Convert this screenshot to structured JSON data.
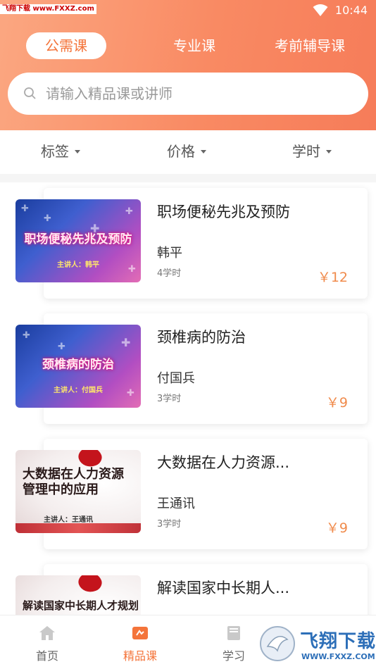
{
  "status_bar": {
    "watermark": "飞翔下载 www.FXXZ.com",
    "time": "10:44"
  },
  "tabs": [
    {
      "label": "公需课",
      "active": true
    },
    {
      "label": "专业课",
      "active": false
    },
    {
      "label": "考前辅导课",
      "active": false
    }
  ],
  "search": {
    "placeholder": "请输入精品课或讲师"
  },
  "filters": [
    {
      "label": "标签"
    },
    {
      "label": "价格"
    },
    {
      "label": "学时"
    }
  ],
  "courses": [
    {
      "thumb_title": "职场便秘先兆及预防",
      "thumb_speaker": "主讲人：韩平",
      "title": "职场便秘先兆及预防",
      "teacher": "韩平",
      "hours": "4学时",
      "price": "￥12"
    },
    {
      "thumb_title": "颈椎病的防治",
      "thumb_speaker": "主讲人：付国兵",
      "title": "颈椎病的防治",
      "teacher": "付国兵",
      "hours": "3学时",
      "price": "￥9"
    },
    {
      "thumb_title_line1": "大数据在人力资源",
      "thumb_title_line2": "管理中的应用",
      "thumb_speaker": "主讲人：王通讯",
      "title": "大数据在人力资源...",
      "teacher": "王通讯",
      "hours": "3学时",
      "price": "￥9"
    },
    {
      "thumb_title": "解读国家中长期人才规划",
      "title": "解读国家中长期人..."
    }
  ],
  "bottom_nav": [
    {
      "label": "首页",
      "icon": "home-icon",
      "active": false
    },
    {
      "label": "精品课",
      "icon": "quality-course-icon",
      "active": true
    },
    {
      "label": "学习",
      "icon": "book-icon",
      "active": false
    }
  ],
  "brand": {
    "name": "飞翔下载",
    "url": "WWW.FXXZ.COM"
  },
  "colors": {
    "accent": "#f4743a",
    "header_start": "#fba781",
    "header_end": "#f67c59",
    "price": "#f08b4c"
  }
}
